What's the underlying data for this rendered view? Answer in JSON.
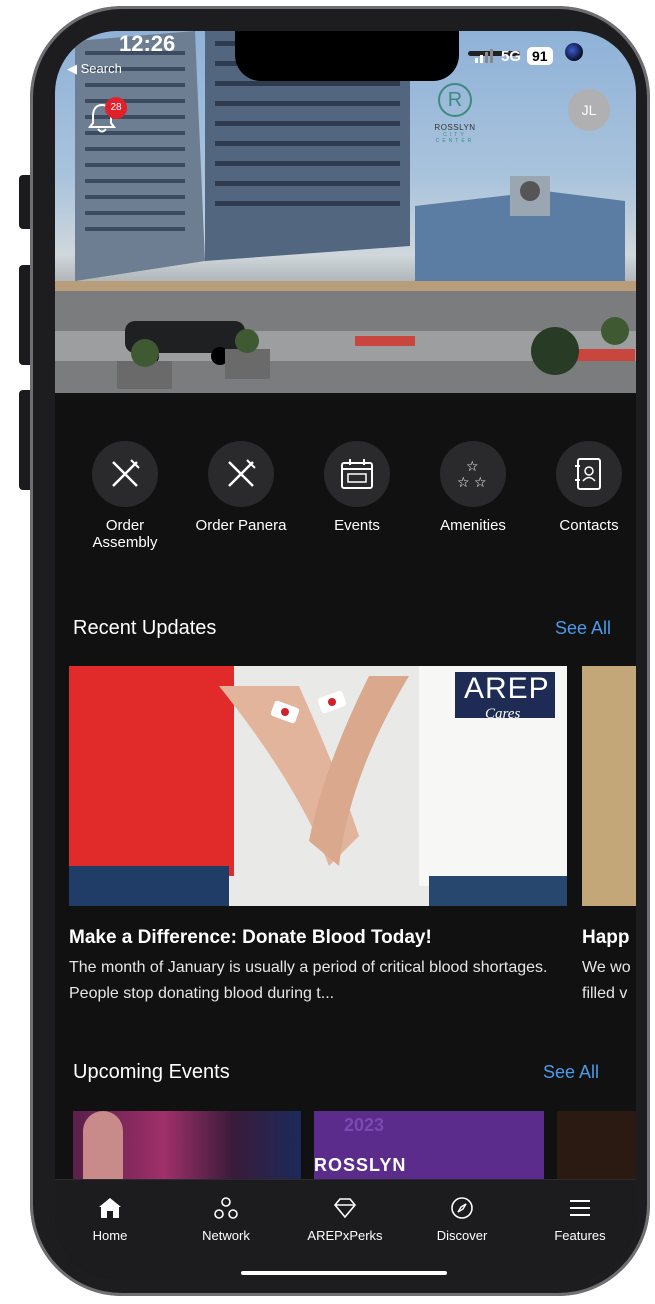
{
  "status_bar": {
    "time": "12:26",
    "back_label": "◀ Search",
    "network": "5G",
    "battery": "91"
  },
  "header": {
    "notification_count": "28",
    "logo_line1": "ROSSLYN",
    "logo_line2": "CITY CENTER",
    "avatar_initials": "JL"
  },
  "quick_actions": [
    {
      "label": "Order Assembly",
      "icon": "utensils-icon"
    },
    {
      "label": "Order Panera",
      "icon": "utensils-icon"
    },
    {
      "label": "Events",
      "icon": "calendar-icon"
    },
    {
      "label": "Amenities",
      "icon": "stars-icon"
    },
    {
      "label": "Contacts",
      "icon": "contact-book-icon"
    }
  ],
  "recent_updates": {
    "title": "Recent Updates",
    "see_all": "See All",
    "cards": [
      {
        "title": "Make a Difference: Donate Blood Today!",
        "description": "The month of January is usually a period of critical blood shortages. People stop donating blood during t...",
        "image_text": "AREP",
        "image_subtext": "Cares"
      },
      {
        "title": "Happ",
        "description_line1": "We wo",
        "description_line2": "filled v"
      }
    ]
  },
  "upcoming_events": {
    "title": "Upcoming Events",
    "see_all": "See All",
    "event_text": "ROSSLYN",
    "event_year": "2023"
  },
  "tab_bar": [
    {
      "label": "Home",
      "icon": "home-icon",
      "active": true
    },
    {
      "label": "Network",
      "icon": "network-icon"
    },
    {
      "label": "AREPxPerks",
      "icon": "diamond-icon"
    },
    {
      "label": "Discover",
      "icon": "compass-icon"
    },
    {
      "label": "Features",
      "icon": "menu-icon"
    }
  ],
  "colors": {
    "background": "#111112",
    "accent": "#4c9be8",
    "badge": "#e0202a",
    "brand": "#3e8a7e"
  }
}
